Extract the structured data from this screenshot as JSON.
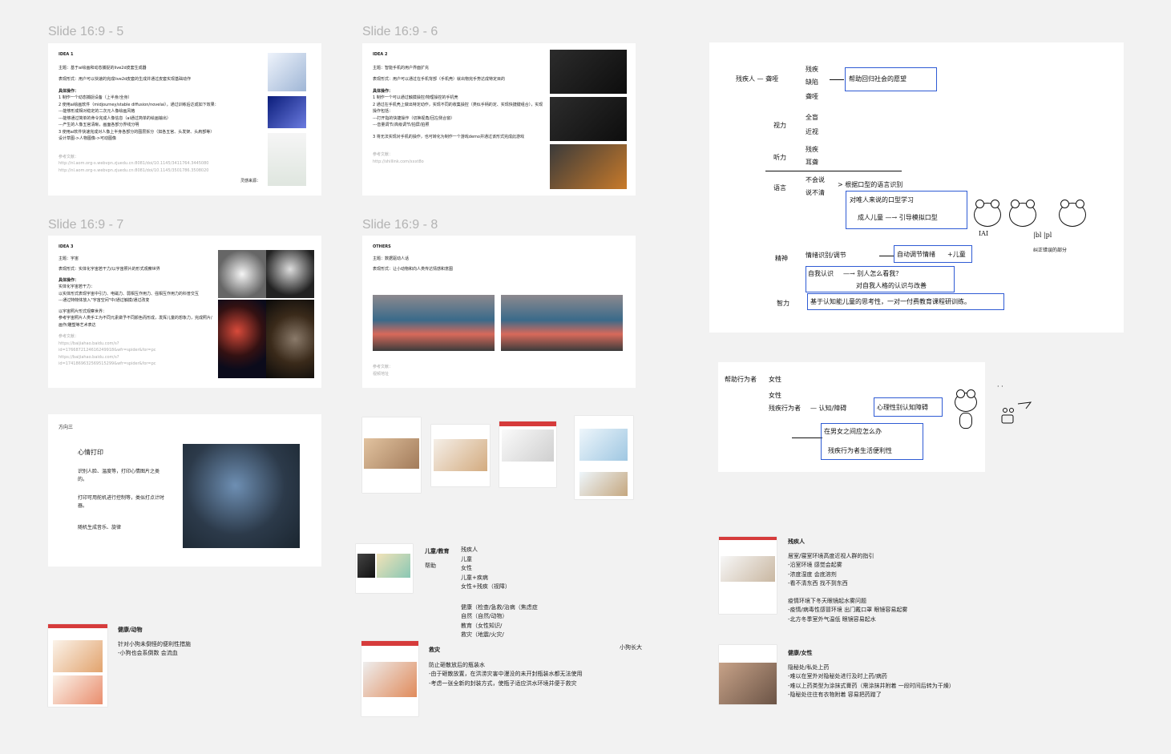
{
  "frames": {
    "f5": "Slide 16:9 - 5",
    "f6": "Slide 16:9 - 6",
    "f7": "Slide 16:9 - 7",
    "f8": "Slide 16:9 - 8"
  },
  "slide5": {
    "title": "IDEA 1",
    "lines": [
      "主题：基于ai绘画和动态捕捉的live2d皮套生成器",
      "表现形式：用户可以快速的完成live2d皮套的生成并通过皮套实现基础动作",
      "具体操作：",
      "1 制作一个动态捕捉设备（上半身/全身）",
      "2 使用ai绘画软件（midjourney/stable diffusion/novelai），通过训练后达成如下效果：",
      "---能够形成相对稳定的二次元人像绘画风格",
      "---能够通过简单的命令完成人像信息（ai通过简单的绘画输出）",
      "---产生的人像五官清晰，画面各部分界线分明",
      "3 使用ai软件快速完成对人像上半身各部分的图层拆分（如各五官、头发架、头肩部等）",
      "设计草图->人物图像->可动图像"
    ],
    "ref_label": "参考文献：",
    "ref1": "http://nl.aom.org-s.webvpn.zjuedu.cn:8081/doi/10.1145/3411764.3445080",
    "ref2": "http://nl.aom.org-s.webvpn.zjuedu.cn:8081/doi/10.1145/3501786.3508020",
    "source": "灵感来源："
  },
  "slide6": {
    "title": "IDEA 2",
    "lines": [
      "主题：智能手机的用户界面扩充",
      "表现形式：用户可以通过在手机背部（手机壳）就出物完手势达成特定目的",
      "具体操作：",
      "1 制作一个可以通过触摸操控/物理操控的手机壳",
      "2 通过在手机壳上做出特定动作，实现不同的收集操控（类似手柄的定、实现快捷键组合），实现操作包括：",
      "---打开指的快捷操作（切换视角/回左侧合窗）",
      "---音量调节/高级调节/拍屏/拍照",
      "3 将无法实现对手机的操作，也可转化为制作一个游戏demo并通过该形式完成此游戏"
    ],
    "ref_label": "参考文献：",
    "ref1": "http://shillink.com/xxxt8o"
  },
  "slide7": {
    "title": "IDEA 3",
    "lines": [
      "主题：宇宙",
      "表现形式：实体化宇宙若干力/以宇宙照片的形式观察世界",
      "具体操作：",
      "实体化宇宙若干力：",
      "以实体形式表现宇宙中引力、电磁力、弱相互作用力、强相互作用力的科普交互",
      "---通过特物体放入\"宇宙空间\"中/通过触摸/通过改变",
      "以宇宙照片形式观察世界：",
      "参考宇宙照片人类手工为不同元素做予不同颜色而形成，发挥儿童的想象力，完成照片/画作/雕塑等艺术表达"
    ],
    "ref_label": "参考文献：",
    "ref1": "https://baijiahao.baidu.com/s?id=1766872124616249918&wfr=spider&for=pc",
    "ref2": "https://baijiahao.baidu.com/s?id=1741869632569515299&wfr=spider&for=pc"
  },
  "slide8": {
    "title": "OTHERS",
    "lines": [
      "主题：数据驱动人话",
      "表现形式：让小动物和向人类传达情感和意图"
    ],
    "ref_label": "参考文献：",
    "ref1": "视频地址"
  },
  "slide9": {
    "label": "方向三",
    "heading": "心情打印",
    "p1": "识别人脸、温度等，打印心情图片之类的。",
    "p2": "打印可用舵机进行控制等，类似打点计时器。",
    "p3": "随机生成音乐、旋律"
  },
  "notes": {
    "kids_title": "儿童/教育",
    "kids_sub": "帮助",
    "groups": [
      "残疾人",
      "儿童",
      "女性",
      "儿童+疾病",
      "女性+残疾（视障）"
    ],
    "fields": [
      "健康（检查/急救/治病（焦虑症",
      "自然（自然/动物）",
      "教育（女性知识/",
      "救灾（地震/火灾/"
    ],
    "rescue_title": "救灾",
    "rescue_lines": [
      "防止砸散放后的瓶装水",
      "-由于砸散放置，在洪涝灾害中漫没的未开封瓶装水都无法使用",
      "-考虑一张全新的封装方式，使瓶子适应洪水环境并便于救灾"
    ],
    "puppy": "小狗长大",
    "health_title": "健康/动物",
    "health_lines": [
      "针对小狗未倒怪的便利性措施",
      "-小狗也会系倒数 会流血"
    ],
    "disabled_title": "残疾人",
    "disabled_lines": [
      "居室/寝室环境高度近视人群的指引",
      "-沿室环境 感觉会起雾",
      "-浓度湿度 会底溶剂",
      "-看不清东西 找不到东西",
      "疫情环境下冬天眼镜起水雾问题",
      "-疫情/病毒性感冒环境 出门戴口罩 眼镜容易起雾",
      "-北方冬季室外气温低 眼镜容易起水"
    ],
    "women_title": "健康/女性",
    "women_lines": [
      "隐秘处/私处上药",
      "-难以在室外对隐秘处进行及时上药/病药",
      "-难以上药类型为涂抹式膏药（需涂抹并附着 一段时间后转为干燥）",
      "-隐秘处往往有衣物附着 容易把药蹭了"
    ]
  },
  "whiteboard1": {
    "who": "残疾人 — 聋哑",
    "m1": "残疾",
    "m2": "缺陷",
    "m3": "聋哑",
    "help": "帮助回归社会的愿望",
    "p_label": "视力",
    "p1": "全盲",
    "p2": "近视",
    "h_label": "听力",
    "h1": "残疾",
    "h2": "耳聋",
    "s_label": "语言",
    "s1": "不会说",
    "s2": "说不清",
    "arrow1": "> 根据口型的语言识别",
    "box1a": "对唯人来说的口型学习",
    "box1b": "成人儿童 —→ 引导模拟口型",
    "tag1": "IAI",
    "ratio": "|bl |pl",
    "ratio_note": "纠正错误的部分",
    "spirit_label": "精神",
    "sp1": "情绪识别/调节",
    "box2": "自动调节情绪",
    "tag2": "+儿童",
    "box3": "自我认识",
    "sp2": "—→ 别人怎么看我？",
    "sp3": "对自我人格的认识与改善",
    "smart_label": "智力",
    "box4": "基于认知能儿童的思考性，一对一付费教育课程研训练。"
  },
  "whiteboard2": {
    "col1": "帮助行为者",
    "col2a": "女性",
    "col2b": "女性",
    "item": "残疾行为者",
    "mid": "— 认知/障碍",
    "box1": "心理性别认知障碍",
    "box2a": "在男女之间应怎么办",
    "box2b": "残疾行为者生活便利性",
    "dots": "· ·"
  },
  "colors": {
    "accent_blue": "#2f5bd4",
    "frame_label": "#b3b3b3",
    "canvas": "#f2f2f2"
  }
}
